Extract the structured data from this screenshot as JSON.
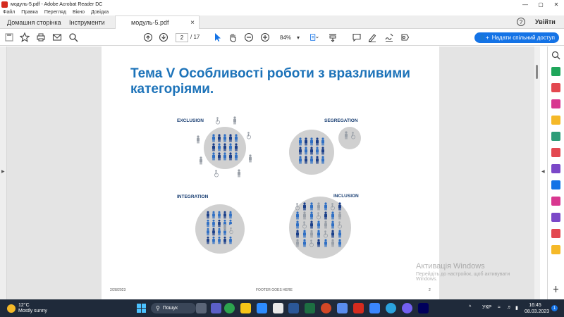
{
  "window": {
    "title": "модуль-5.pdf - Adobe Acrobat Reader DC",
    "controls": [
      "—",
      "▢",
      "✕"
    ]
  },
  "menu": [
    "Файл",
    "Правка",
    "Перегляд",
    "Вікно",
    "Довідка"
  ],
  "tabs": {
    "home": "Домашня сторінка",
    "tools": "Інструменти",
    "document": "модуль-5.pdf",
    "help": "?",
    "login": "Увійти"
  },
  "toolbar": {
    "page_current": "2",
    "page_total": "/ 17",
    "zoom": "84%",
    "share_label": "Надати спільний доступ"
  },
  "slide": {
    "title": "Тема V Особливості роботи з вразливими категоріями.",
    "labels": {
      "exclusion": "EXCLUSION",
      "segregation": "SEGREGATION",
      "integration": "INTEGRATION",
      "inclusion": "INCLUSION"
    },
    "footer_left": "2/28/2023",
    "footer_center": "FOOTER GOES HERE",
    "footer_right": "2"
  },
  "watermark": {
    "line1": "Активація Windows",
    "line2": "Перейдіть до настройок, щоб активувати",
    "line3": "Windows."
  },
  "taskbar": {
    "temperature": "12°C",
    "weather": "Mostly sunny",
    "search": "Пошук",
    "lang": "УКР",
    "time": "16:45",
    "date": "08.03.2023",
    "notifications": "1"
  },
  "colors": {
    "title_blue": "#1d73b9",
    "accent": "#1473e6",
    "person_dark": "#1a3f8a",
    "person_mid": "#2f6fc4",
    "person_grey": "#9aa0a8",
    "circle_grey": "#d0d0d0"
  },
  "icons": {
    "pdf_app": "acrobat-icon",
    "share": "person-plus-icon"
  }
}
